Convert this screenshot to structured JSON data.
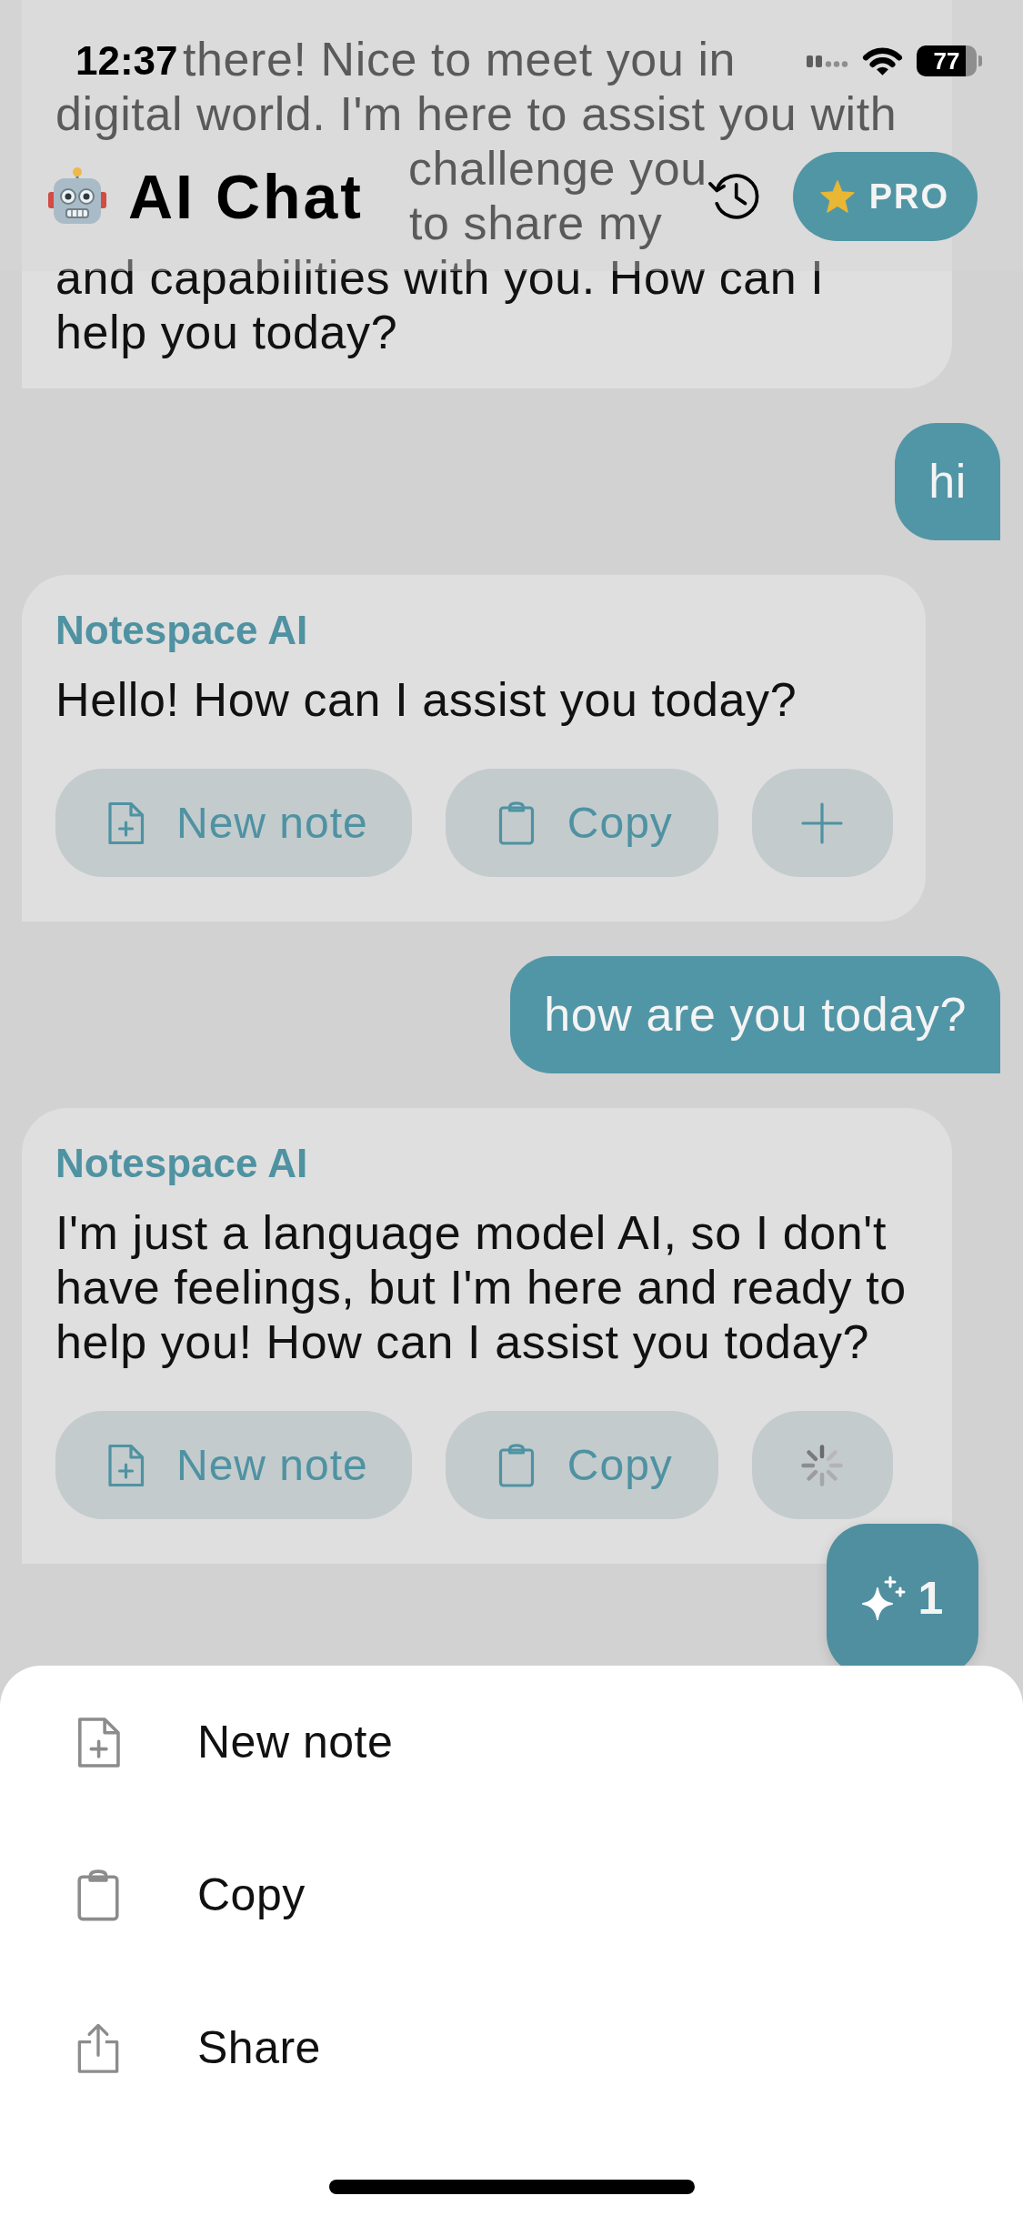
{
  "status_bar": {
    "time": "12:37",
    "battery": "77"
  },
  "header": {
    "title": "AI Chat",
    "pro_label": "PRO"
  },
  "messages": [
    {
      "kind": "ai",
      "partial_lines": [
        "there! Nice to meet you in",
        "digital world. I'm here to assist you with",
        "challenge you",
        "to share my"
      ],
      "text": "and capabilities with you. How can I help you today?"
    },
    {
      "kind": "user",
      "text": "hi"
    },
    {
      "kind": "ai",
      "name": "Notespace AI",
      "text": "Hello! How can I assist you today?",
      "actions": [
        {
          "kind": "new_note",
          "label": "New note"
        },
        {
          "kind": "copy",
          "label": "Copy"
        },
        {
          "kind": "add"
        }
      ]
    },
    {
      "kind": "user",
      "text": "how are you today?"
    },
    {
      "kind": "ai",
      "name": "Notespace AI",
      "text": "I'm just a language model AI, so I don't have feelings, but I'm here and ready to help you! How can I assist you today?",
      "actions": [
        {
          "kind": "new_note",
          "label": "New note"
        },
        {
          "kind": "copy",
          "label": "Copy"
        },
        {
          "kind": "loading"
        }
      ]
    }
  ],
  "floating_button": {
    "count": "1"
  },
  "action_sheet": {
    "items": [
      {
        "kind": "new_note",
        "label": "New note"
      },
      {
        "kind": "copy",
        "label": "Copy"
      },
      {
        "kind": "share",
        "label": "Share"
      }
    ]
  }
}
